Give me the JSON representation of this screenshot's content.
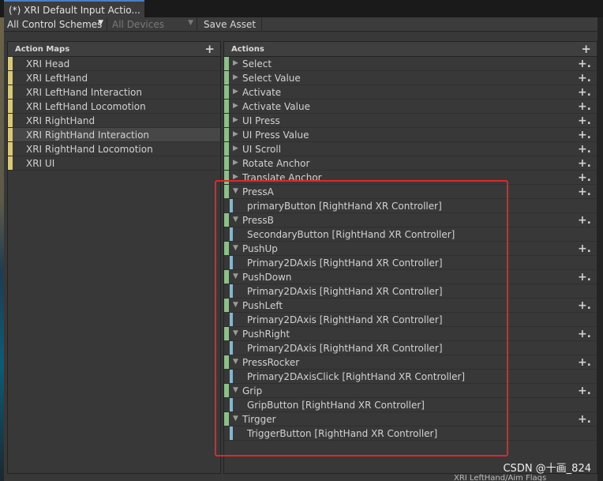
{
  "window": {
    "tab_title": "(*) XRI Default Input Actio..."
  },
  "toolbar": {
    "control_schemes": "All Control Schemes",
    "devices": "All Devices",
    "save_asset": "Save Asset"
  },
  "action_maps": {
    "header": "Action Maps",
    "items": [
      {
        "label": "XRI Head"
      },
      {
        "label": "XRI LeftHand"
      },
      {
        "label": "XRI LeftHand Interaction"
      },
      {
        "label": "XRI LeftHand Locomotion"
      },
      {
        "label": "XRI RightHand"
      },
      {
        "label": "XRI RightHand Interaction"
      },
      {
        "label": "XRI RightHand Locomotion"
      },
      {
        "label": "XRI UI"
      }
    ],
    "selected_index": 5
  },
  "actions": {
    "header": "Actions",
    "collapsed": [
      {
        "label": "Select"
      },
      {
        "label": "Select Value"
      },
      {
        "label": "Activate"
      },
      {
        "label": "Activate Value"
      },
      {
        "label": "UI Press"
      },
      {
        "label": "UI Press Value"
      },
      {
        "label": "UI Scroll"
      },
      {
        "label": "Rotate Anchor"
      },
      {
        "label": "Translate Anchor"
      }
    ],
    "expanded": [
      {
        "label": "PressA",
        "binding": "primaryButton [RightHand XR Controller]"
      },
      {
        "label": "PressB",
        "binding": "SecondaryButton [RightHand XR Controller]"
      },
      {
        "label": "PushUp",
        "binding": "Primary2DAxis [RightHand XR Controller]"
      },
      {
        "label": "PushDown",
        "binding": "Primary2DAxis [RightHand XR Controller]"
      },
      {
        "label": "PushLeft",
        "binding": "Primary2DAxis [RightHand XR Controller]"
      },
      {
        "label": "PushRight",
        "binding": "Primary2DAxis [RightHand XR Controller]"
      },
      {
        "label": "PressRocker",
        "binding": "Primary2DAxisClick [RightHand XR Controller]"
      },
      {
        "label": "Grip",
        "binding": "GripButton [RightHand XR Controller]"
      },
      {
        "label": "Tirgger",
        "binding": "TriggerButton [RightHand XR Controller]"
      }
    ]
  },
  "watermark": "CSDN @十画_824",
  "footer": "XRI LeftHand/Aim Flags"
}
